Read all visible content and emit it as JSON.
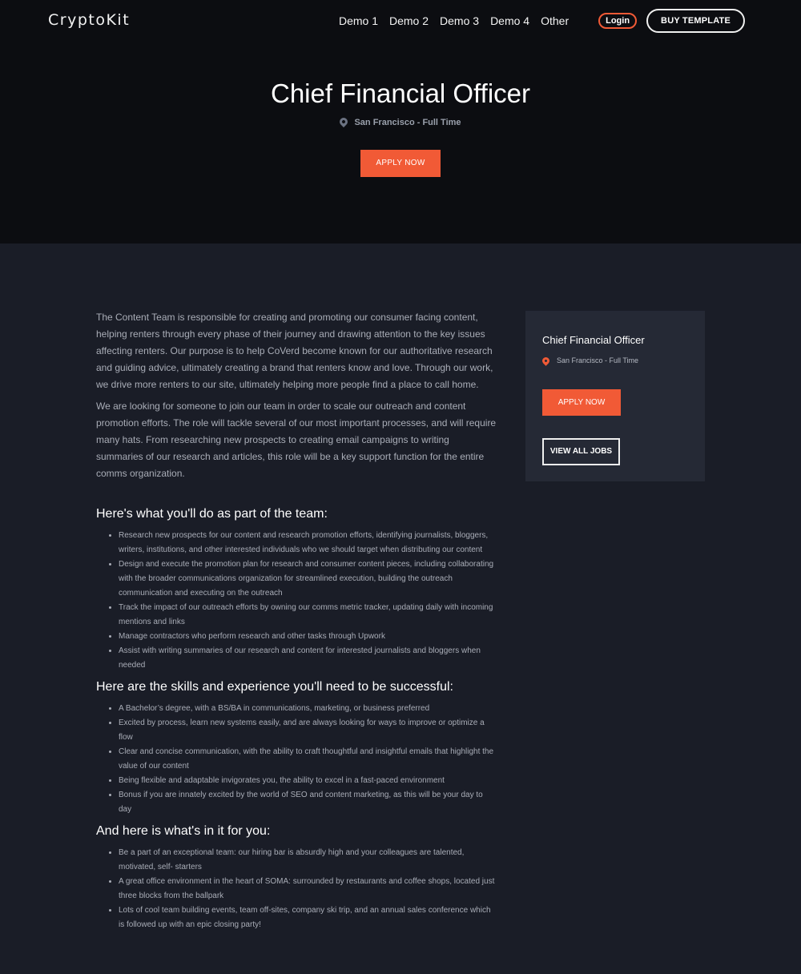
{
  "nav": {
    "logo": "CryptoKit",
    "links": [
      "Demo 1",
      "Demo 2",
      "Demo 3",
      "Demo 4",
      "Other"
    ],
    "login": "Login",
    "buy": "BUY TEMPLATE"
  },
  "hero": {
    "title": "Chief Financial Officer",
    "location": "San Francisco - Full Time",
    "apply": "APPLY NOW"
  },
  "content": {
    "paragraphs": [
      "The Content Team is responsible for creating and promoting our consumer facing content, helping renters through every phase of their journey and drawing attention to the key issues affecting renters. Our purpose is to help CoVerd become known for our authoritative research and guiding advice, ultimately creating a brand that renters know and love. Through our work, we drive more renters to our site, ultimately helping more people find a place to call home.",
      "We are looking for someone to join our team in order to scale our outreach and content promotion efforts. The role will tackle several of our most important processes, and will require many hats. From researching new prospects to creating email campaigns to writing summaries of our research and articles, this role will be a key support function for the entire comms organization."
    ],
    "sections": [
      {
        "heading": "Here's what you'll do as part of the team:",
        "items": [
          "Research new prospects for our content and research promotion efforts, identifying journalists, bloggers, writers, institutions, and other interested individuals who we should target when distributing our content",
          "Design and execute the promotion plan for research and consumer content pieces, including collaborating with the broader communications organization for streamlined execution, building the outreach communication and executing on the outreach",
          "Track the impact of our outreach efforts by owning our comms metric tracker, updating daily with incoming mentions and links",
          "Manage contractors who perform research and other tasks through Upwork",
          "Assist with writing summaries of our research and content for interested journalists and bloggers when needed"
        ]
      },
      {
        "heading": "Here are the skills and experience you'll need to be successful:",
        "items": [
          "A Bachelor’s degree, with a BS/BA in communications, marketing, or business preferred",
          "Excited by process, learn new systems easily, and are always looking for ways to improve or optimize a flow",
          "Clear and concise communication, with the ability to craft thoughtful and insightful emails that highlight the value of our content",
          "Being flexible and adaptable invigorates you, the ability to excel in a fast-paced environment",
          "Bonus if you are innately excited by the world of SEO and content marketing, as this will be your day to day"
        ]
      },
      {
        "heading": "And here is what's in it for you:",
        "items": [
          "Be a part of an exceptional team: our hiring bar is absurdly high and your colleagues are talented, motivated, self- starters",
          "A great office environment in the heart of SOMA: surrounded by restaurants and coffee shops, located just three blocks from the ballpark",
          "Lots of cool team building events, team off-sites, company ski trip, and an annual sales conference which is followed up with an epic closing party!"
        ]
      }
    ]
  },
  "sidebar": {
    "title": "Chief Financial Officer",
    "location": "San Francisco - Full Time",
    "apply": "APPLY NOW",
    "view_all": "VIEW ALL JOBS"
  },
  "colors": {
    "accent": "#f15a36",
    "hero_bg": "#0c0d11",
    "body_bg": "#1a1d27",
    "card_bg": "#252935"
  },
  "icons": {
    "location": "map-pin-icon"
  }
}
